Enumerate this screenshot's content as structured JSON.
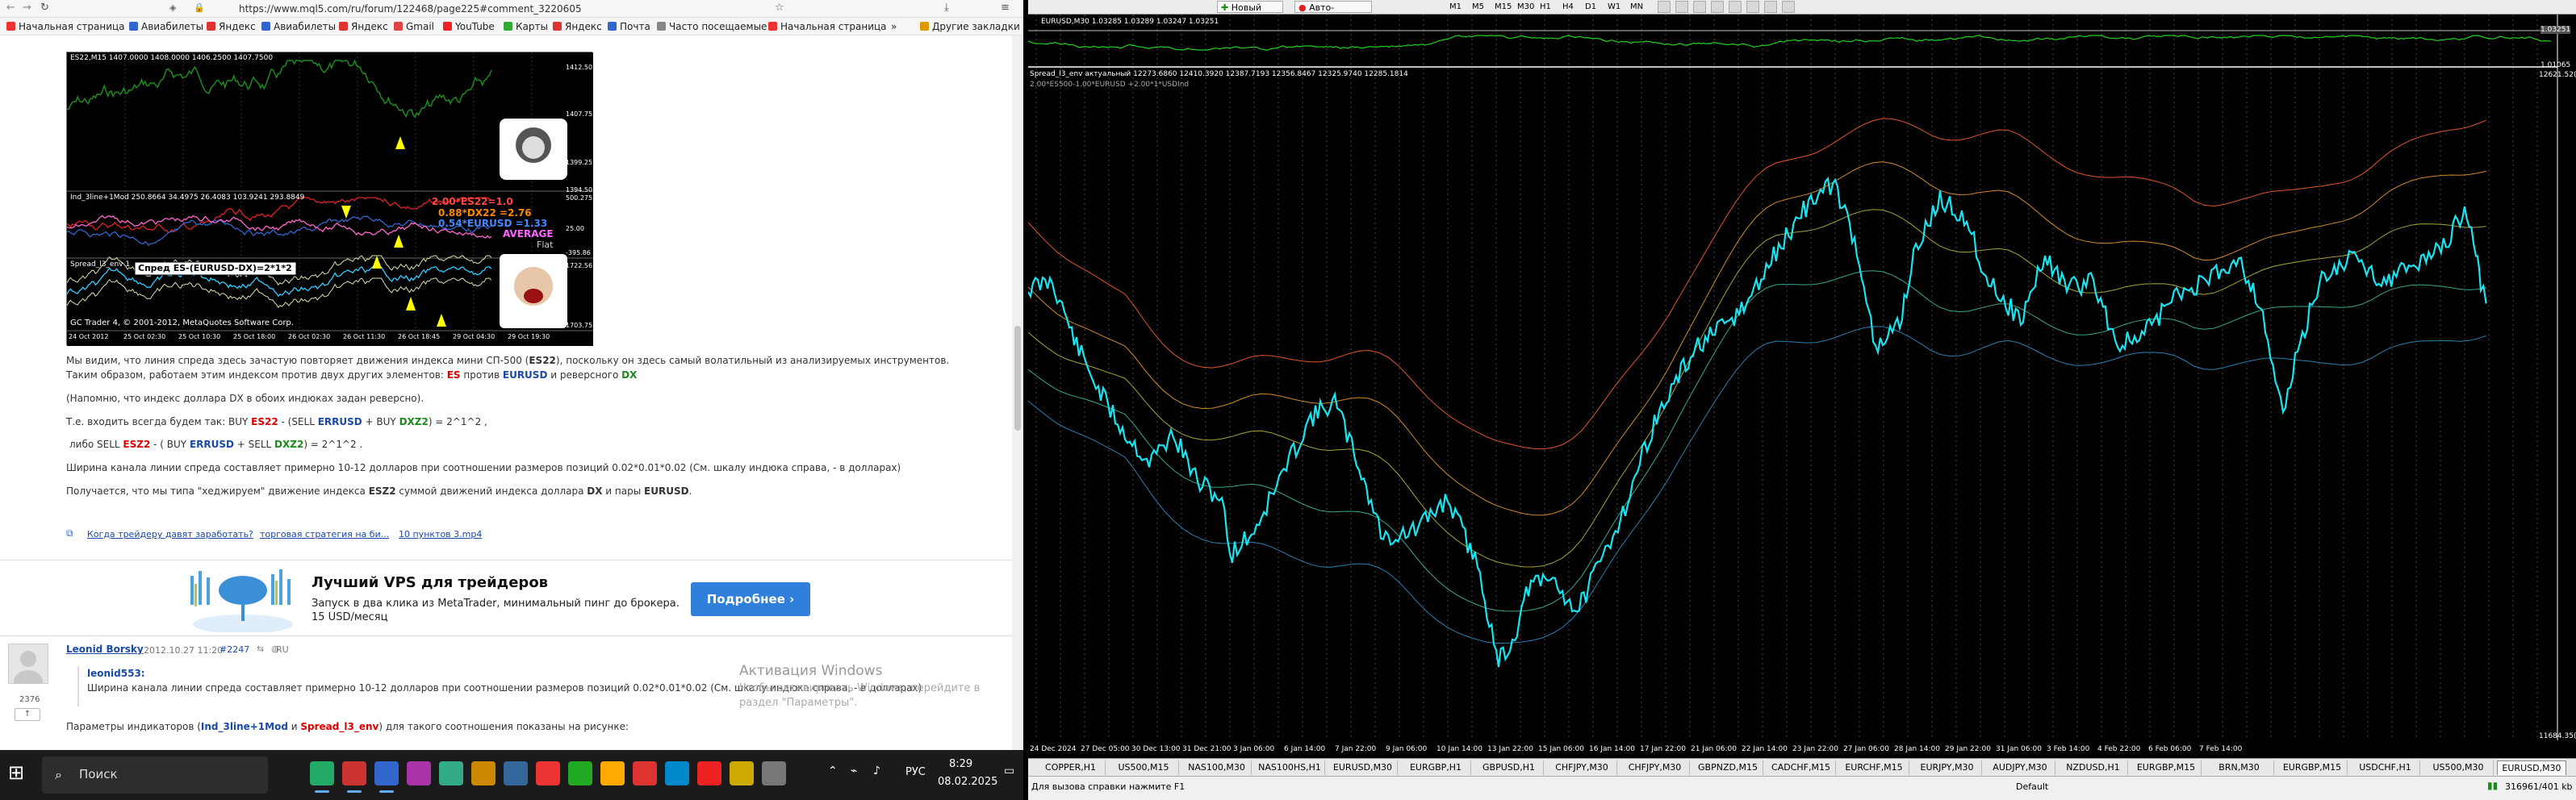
{
  "browser": {
    "url": "https://www.mql5.com/ru/forum/122468/page225#comment_3220605",
    "bookmarks": [
      "Начальная страница",
      "Авиабилеты",
      "Яндекс",
      "Авиабилеты",
      "Яндекс",
      "Gmail",
      "YouTube",
      "Карты",
      "Яндекс",
      "Почта",
      "Часто посещаемые",
      "Начальная страница",
      "»",
      "Другие закладки"
    ],
    "chart_header": "ES22,M15  1407.0000 1408.0000 1406.2500 1407.7500",
    "chart_ind": "Ind_3line+1Mod  250.8664 34.4975 26.4083 103.9241 293.8849",
    "chart_spread": "Spread_l3_env 1",
    "chart_tooltip": "Спред ES-(EURUSD-DX)=2*1*2",
    "chart_copyright": "GC Trader 4, © 2001-2012, MetaQuotes Software Corp.",
    "chart_formula1": "2.00*ES22=1.0",
    "chart_formula2": "0.88*DX22 =2.76",
    "chart_formula3": "0.54*EURUSD =1.33",
    "chart_avg": "AVERAGE",
    "chart_flat": "Flat",
    "chart_yvals": [
      "1412.50",
      "1407.75",
      "1399.25",
      "1394.50",
      "500.275",
      "25.00",
      "-395.86",
      "1722.56",
      "1703.75"
    ],
    "chart_dates": [
      "24 Oct 2012",
      "25 Oct 02:30",
      "25 Oct 10:30",
      "25 Oct 18:00",
      "26 Oct 02:30",
      "26 Oct 11:30",
      "26 Oct 18:45",
      "29 Oct 04:30",
      "29 Oct 19:30"
    ],
    "p1a": "Мы видим, что линия спреда  здесь зачастую повторяет движения индекса мини СП-500 (",
    "p1b": "ES22",
    "p1c": "), поскольку он здесь самый волатильный из анализируемых инструментов.",
    "p2a": "Таким образом, работаем этим индексом против двух других элементов: ",
    "p2es": "ES",
    "p2b": "  против ",
    "p2eu": "EURUSD",
    "p2c": " и реверсного ",
    "p2dx": "DX",
    "p3": "(Напомню, что индекс доллара DX в обоих индюках задан реверсно).",
    "p4a": "Т.е. входить всегда будем так: BUY ",
    "p4es": "ES22",
    "p4b": " - (SELL ",
    "p4eu": "ERRUSD",
    "p4c": " + BUY ",
    "p4dx": "DXZ2",
    "p4d": ") = 2^1^2 ,",
    "p5a": "либо  SELL ",
    "p5es": "ESZ2",
    "p5b": " - ( BUY  ",
    "p5eu": "ERRUSD",
    "p5c": " + SELL ",
    "p5dx": "DXZ2",
    "p5d": ") = 2^1^2 .",
    "p6": "Ширина канала линии спреда составляет примерно 10-12 долларов при соотношении размеров позиций 0.02*0.01*0.02 (См. шкалу индюка справа, - в долларах)",
    "p7a": "Получается, что мы типа \"хеджируем\" движение индекса ",
    "p7b": "ESZ2",
    "p7c": " суммой движений индекса доллара ",
    "p7d": "DX",
    "p7e": " и пары ",
    "p7f": "EURUSD",
    "p7g": ".",
    "link1": "Когда трейдеру давят заработать?",
    "link2": "торговая стратегия на би...",
    "link3": "10 пунктов 3.mp4",
    "ad_title": "Лучший VPS для трейдеров",
    "ad_text": "Запуск в два клика из MetaTrader, минимальный пинг до брокера. 15 USD/месяц",
    "ad_button": "Подробнее",
    "author": "Leonid Borsky",
    "post_date": "2012.10.27 11:20",
    "post_num": "#2247",
    "post_ru": "RU",
    "rating": "2376",
    "quote_author": "leonid553:",
    "quote_text": "Ширина канала линии спреда составляет примерно 10-12 долларов при соотношении размеров позиций 0.02*0.01*0.02 (См. шкалу индюка справа, - в долларах)",
    "bottom_a": "Параметры индикаторов (",
    "bottom_b": "Ind_3line+1Mod",
    "bottom_c": " и ",
    "bottom_d": "Spread_l3_env",
    "bottom_e": ")  для такого соотношения показаны на рисунке:",
    "watermark1": "Активация Windows",
    "watermark2": "Чтобы активировать Windows, перейдите в",
    "watermark3": "раздел \"Параметры\"."
  },
  "taskbar": {
    "search": "Поиск",
    "lang": "РУС",
    "time": "8:29",
    "date": "08.02.2025"
  },
  "terminal": {
    "menu_new_order": "Новый ордер",
    "menu_autotrade": "Авто-торговля",
    "timeframes": [
      "M1",
      "M5",
      "M15",
      "M30",
      "H1",
      "H4",
      "D1",
      "W1",
      "MN"
    ],
    "header": "EURUSD,M30  1.03285 1.03289 1.03247 1.03251",
    "sub_header": "Spread_l3_env актуальный 12273.6860 12410.3920 12387.7193 12356.8467 12325.9740 12285.1814",
    "sub_formula": "2.00*ES500-1.00*EURUSD +2.00*1*USDInd",
    "price_top": "1.03251",
    "price_mid": "1.01065",
    "price_label": "12621.52(6)",
    "price_bottom": "11684.35(2)",
    "dates": [
      "24 Dec 2024",
      "27 Dec 05:00",
      "30 Dec 13:00",
      "31 Dec 21:00",
      "3 Jan 06:00",
      "6 Jan 14:00",
      "7 Jan 22:00",
      "9 Jan 06:00",
      "10 Jan 14:00",
      "13 Jan 22:00",
      "15 Jan 06:00",
      "16 Jan 14:00",
      "17 Jan 22:00",
      "21 Jan 06:00",
      "22 Jan 14:00",
      "23 Jan 22:00",
      "27 Jan 06:00",
      "28 Jan 14:00",
      "29 Jan 22:00",
      "31 Jan 06:00",
      "3 Feb 14:00",
      "4 Feb 22:00",
      "6 Feb 06:00",
      "7 Feb 14:00"
    ],
    "tabs": [
      "COPPER,H1",
      "US500,M15",
      "NAS100,M30",
      "NAS100HS,H1",
      "EURUSD,M30",
      "EURGBP,H1",
      "GBPUSD,H1",
      "CHFJPY,M30",
      "CHFJPY,M30",
      "GBPNZD,M15",
      "CADCHF,M15",
      "EURCHF,M15",
      "EURJPY,M30",
      "AUDJPY,M30",
      "NZDUSD,H1",
      "EURGBP,M15",
      "BRN,M30",
      "EURGBP,M15",
      "USDCHF,H1",
      "US500,M30",
      "EURUSD,M30"
    ],
    "status_left": "Для вызова справки нажмите F1",
    "status_profile": "Default",
    "status_right": "316961/401 kb"
  }
}
